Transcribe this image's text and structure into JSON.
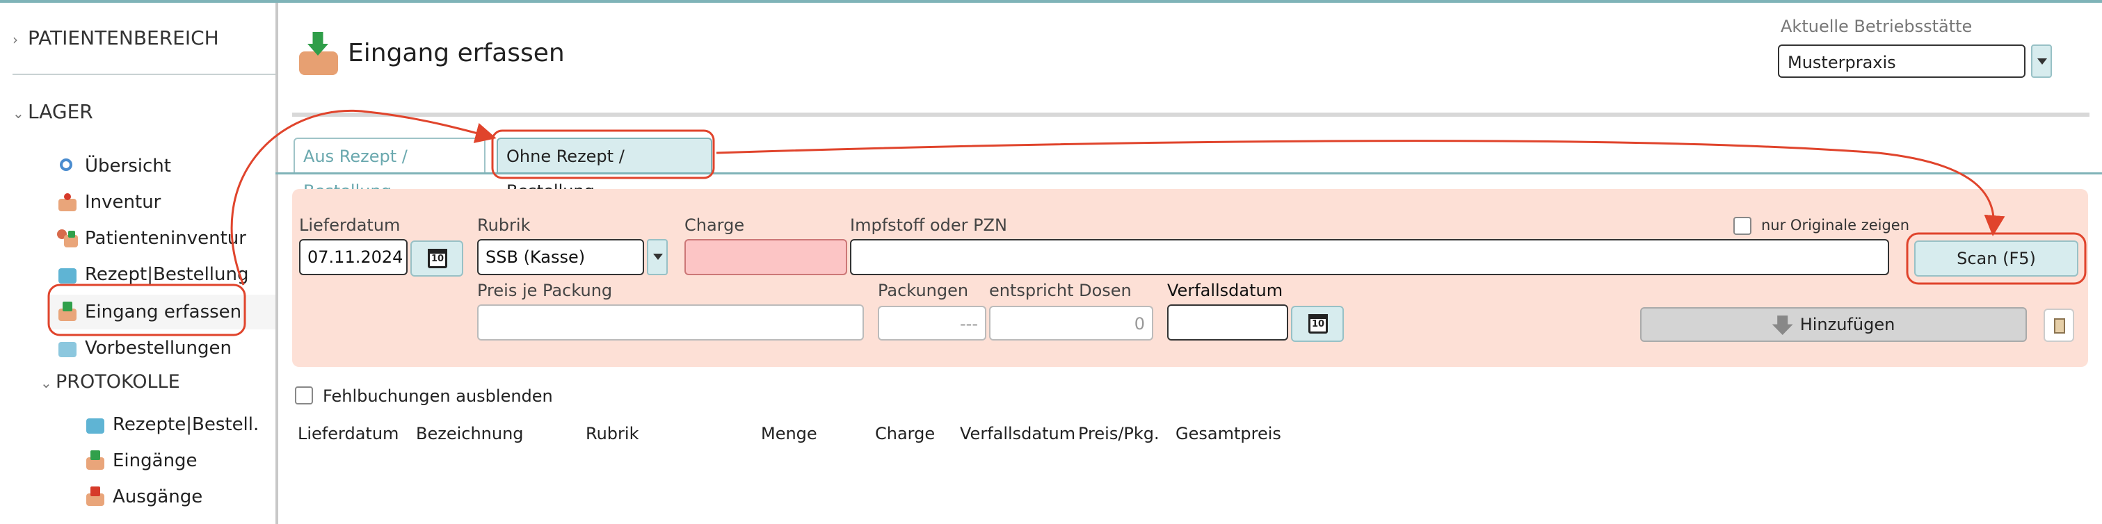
{
  "sidebar": {
    "sections": [
      {
        "label": "PATIENTENBEREICH"
      },
      {
        "label": "LAGER"
      },
      {
        "label": "PROTOKOLLE"
      }
    ],
    "lager_items": [
      {
        "label": "Übersicht",
        "icon": "magnifier-icon"
      },
      {
        "label": "Inventur",
        "icon": "inventory-box-icon"
      },
      {
        "label": "Patienteninventur",
        "icon": "patient-inventory-icon"
      },
      {
        "label": "Rezept|Bestellung",
        "icon": "prescription-icon"
      },
      {
        "label": "Eingang erfassen",
        "icon": "incoming-box-icon"
      },
      {
        "label": "Vorbestellungen",
        "icon": "preorder-icon"
      }
    ],
    "protokolle_items": [
      {
        "label": "Rezepte|Bestell.",
        "icon": "prescription-icon"
      },
      {
        "label": "Eingänge",
        "icon": "incoming-box-icon"
      },
      {
        "label": "Ausgänge",
        "icon": "outgoing-box-icon"
      }
    ]
  },
  "header": {
    "title": "Eingang erfassen",
    "site_label": "Aktuelle Betriebsstätte",
    "site_value": "Musterpraxis"
  },
  "tabs": [
    {
      "label": "Aus Rezept / Bestellung"
    },
    {
      "label": "Ohne Rezept / Bestellung"
    }
  ],
  "form": {
    "lieferdatum_label": "Lieferdatum",
    "lieferdatum_value": "07.11.2024",
    "rubrik_label": "Rubrik",
    "rubrik_value": "SSB (Kasse)",
    "charge_label": "Charge",
    "impfstoff_label": "Impfstoff oder PZN",
    "nur_originale_label": "nur Originale zeigen",
    "scan_label": "Scan (F5)",
    "preis_label": "Preis je Packung",
    "packungen_label": "Packungen",
    "packungen_value": "---",
    "dosen_label": "entspricht Dosen",
    "dosen_value": "0",
    "verfall_label": "Verfallsdatum",
    "hinzufuegen_label": "Hinzufügen",
    "calendar_day": "10"
  },
  "fehlbuchungen_label": "Fehlbuchungen ausblenden",
  "table_headers": [
    "Lieferdatum",
    "Bezeichnung",
    "Rubrik",
    "Menge",
    "Charge",
    "Verfallsdatum",
    "Preis/Pkg.",
    "Gesamtpreis"
  ],
  "colors": {
    "accent": "#7fb3b8",
    "panel": "#fde0d6",
    "annotation": "#e0442c"
  }
}
